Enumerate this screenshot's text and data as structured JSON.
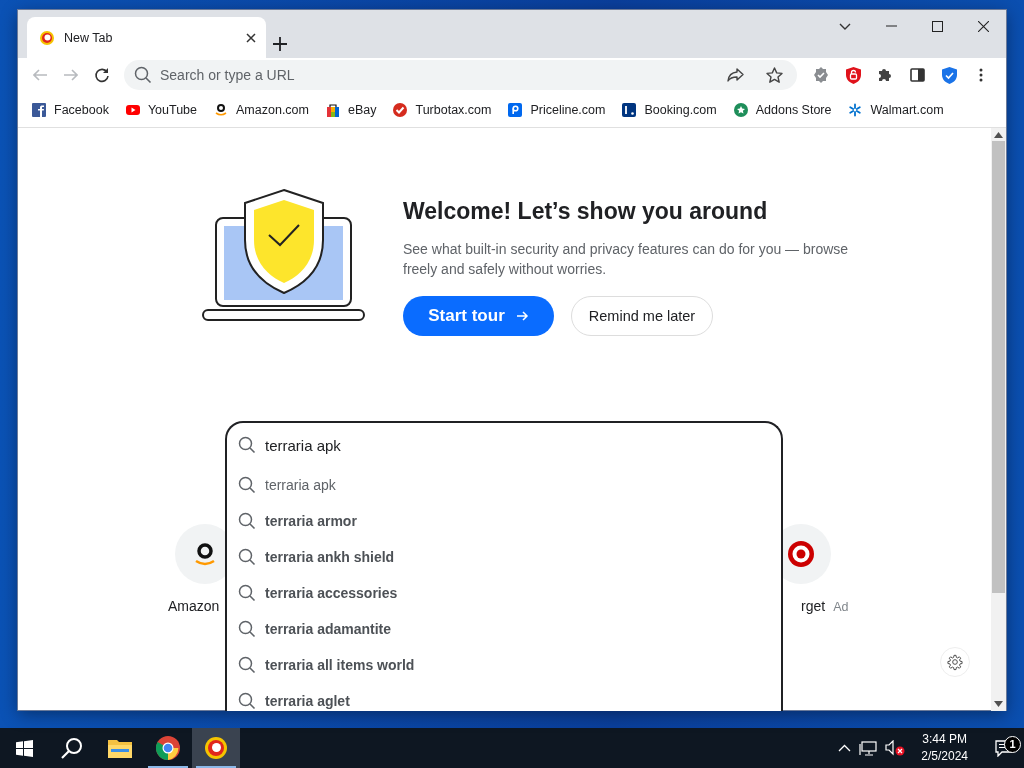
{
  "tab": {
    "title": "New Tab",
    "selected": true
  },
  "address_bar": {
    "placeholder": "Search or type a URL"
  },
  "bookmarks": [
    {
      "label": "Facebook",
      "kind": "facebook"
    },
    {
      "label": "YouTube",
      "kind": "youtube"
    },
    {
      "label": "Amazon.com",
      "kind": "amazon"
    },
    {
      "label": "eBay",
      "kind": "ebay"
    },
    {
      "label": "Turbotax.com",
      "kind": "turbotax"
    },
    {
      "label": "Priceline.com",
      "kind": "priceline"
    },
    {
      "label": "Booking.com",
      "kind": "booking"
    },
    {
      "label": "Addons Store",
      "kind": "addons"
    },
    {
      "label": "Walmart.com",
      "kind": "walmart"
    }
  ],
  "welcome": {
    "title": "Welcome! Let’s show you around",
    "body": "See what built-in security and privacy features can do for you — browse freely and safely without worries.",
    "buttons": [
      {
        "label": "Start tour",
        "kind": "primary"
      },
      {
        "label": "Remind me later",
        "kind": "secondary"
      }
    ]
  },
  "search": {
    "value": "terraria apk",
    "suggestions": [
      {
        "text": "terraria apk",
        "kind": "typed"
      },
      {
        "text": "terraria armor",
        "kind": "completion"
      },
      {
        "text": "terraria ankh shield",
        "kind": "completion"
      },
      {
        "text": "terraria accessories",
        "kind": "completion"
      },
      {
        "text": "terraria adamantite",
        "kind": "completion"
      },
      {
        "text": "terraria all items world",
        "kind": "completion"
      },
      {
        "text": "terraria aglet",
        "kind": "completion"
      }
    ]
  },
  "shortcuts": [
    {
      "label": "Amazon",
      "kind": "amazon"
    },
    {
      "label": "rget",
      "kind": "target",
      "badge": "Ad"
    }
  ],
  "taskbar": {
    "apps": [
      {
        "kind": "files",
        "running": false,
        "selected": false
      },
      {
        "kind": "chrome",
        "running": true,
        "selected": false
      },
      {
        "kind": "browser",
        "running": true,
        "selected": true
      }
    ],
    "volume_muted": true,
    "time": "3:44 PM",
    "date": "2/5/2024",
    "notification_count": "1"
  }
}
